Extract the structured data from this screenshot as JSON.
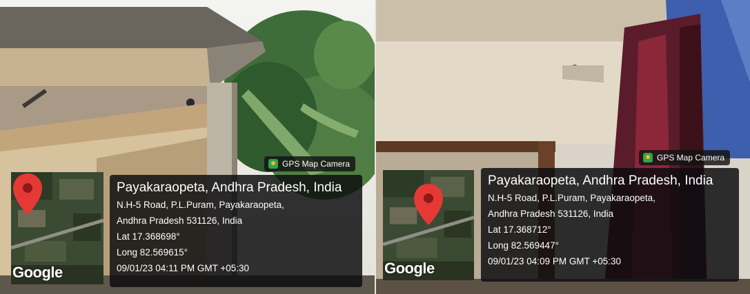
{
  "photos": [
    {
      "gps_tag": "GPS Map Camera",
      "map_logo": "Google",
      "pin_icon": "map-pin-icon",
      "place": "Payakaraopeta, Andhra Pradesh, India",
      "address_line1": "N.H-5 Road, P.L.Puram, Payakaraopeta,",
      "address_line2": "Andhra Pradesh 531126, India",
      "latitude": "Lat 17.368698°",
      "longitude": "Long 82.569615°",
      "timestamp": "09/01/23 04:11 PM GMT +05:30"
    },
    {
      "gps_tag": "GPS Map Camera",
      "map_logo": "Google",
      "pin_icon": "map-pin-icon",
      "place": "Payakaraopeta, Andhra Pradesh, India",
      "address_line1": "N.H-5 Road, P.L.Puram, Payakaraopeta,",
      "address_line2": "Andhra Pradesh 531126, India",
      "latitude": "Lat 17.368712°",
      "longitude": "Long 82.569447°",
      "timestamp": "09/01/23 04:09 PM GMT +05:30"
    }
  ],
  "colors": {
    "pin": "#e53935",
    "overlay": "#0c0c0e",
    "gps_logo": "#2fa34f"
  }
}
